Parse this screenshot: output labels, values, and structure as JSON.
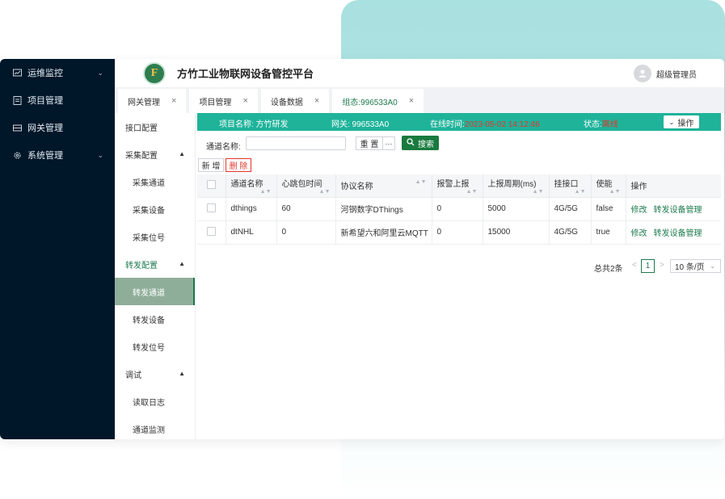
{
  "app": {
    "title": "方竹工业物联网设备管控平台",
    "logo_letter": "F",
    "user_name": "超级管理员"
  },
  "sidebar": {
    "items": [
      {
        "label": "运维监控",
        "icon": "monitor-icon",
        "has_children": true
      },
      {
        "label": "项目管理",
        "icon": "project-icon",
        "has_children": false
      },
      {
        "label": "网关管理",
        "icon": "gateway-icon",
        "has_children": false
      },
      {
        "label": "系统管理",
        "icon": "gear-icon",
        "has_children": true
      }
    ]
  },
  "tabs": [
    {
      "label": "网关管理",
      "active": false
    },
    {
      "label": "项目管理",
      "active": false
    },
    {
      "label": "设备数据",
      "active": false
    },
    {
      "label": "组态:996533A0",
      "active": true
    }
  ],
  "submenu": {
    "top": "接口配置",
    "g1": {
      "label": "采集配置",
      "items": [
        "采集通道",
        "采集设备",
        "采集位号"
      ]
    },
    "g2": {
      "label": "转发配置",
      "items": [
        "转发通道",
        "转发设备",
        "转发位号"
      ]
    },
    "g3": {
      "label": "调试",
      "items": [
        "读取日志",
        "通道监测"
      ]
    }
  },
  "info": {
    "project": "项目名称: 方竹研发",
    "gateway": "网关: 996533A0",
    "online_label": "在线时间:",
    "online_time": "2023-05-02 14:12:46",
    "status_label": "状态:",
    "status": "离线",
    "op_label": "操作"
  },
  "search": {
    "label": "通道名称:",
    "value": "",
    "placeholder": "",
    "reset": "重 置",
    "more": "···",
    "submit": "搜索"
  },
  "actions": {
    "add": "新 增",
    "delete": "删 除"
  },
  "table": {
    "columns": [
      "通道名称",
      "心跳包时间",
      "协议名称",
      "报警上报",
      "上报周期(ms)",
      "挂接口",
      "使能",
      "操作"
    ],
    "rows": [
      {
        "name": "dthings",
        "heartbeat": "60",
        "protocol": "河钢数字DThings",
        "alarm": "0",
        "period": "5000",
        "port": "4G/5G",
        "enable": "false",
        "edit": "修改",
        "manage": "转发设备管理"
      },
      {
        "name": "dtNHL",
        "heartbeat": "0",
        "protocol": "新希望六和阿里云MQTT",
        "alarm": "0",
        "period": "15000",
        "port": "4G/5G",
        "enable": "true",
        "edit": "修改",
        "manage": "转发设备管理"
      }
    ]
  },
  "pagination": {
    "total": "总共2条",
    "page": "1",
    "page_size": "10 条/页"
  },
  "colors": {
    "sidebar_bg": "#001629",
    "accent": "#1d7b4e",
    "infobar": "#1fb39a",
    "danger": "#e3362b"
  }
}
